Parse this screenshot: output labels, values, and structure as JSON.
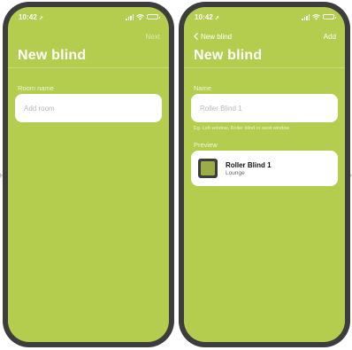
{
  "status_bar": {
    "time": "10:42",
    "location_glyph": "➚"
  },
  "screen1": {
    "nav_action": "Next",
    "title": "New blind",
    "field_label": "Room name",
    "field_placeholder": "Add room"
  },
  "screen2": {
    "back_label": "New blind",
    "nav_action": "Add",
    "title": "New blind",
    "field_label": "Name",
    "field_placeholder": "Roller Blind 1",
    "field_hint": "Eg. Left window, Roller blind or west window",
    "preview_label": "Preview",
    "preview_name": "Roller Blind 1",
    "preview_room": "Lounge"
  },
  "colors": {
    "background": "#b5cd4f",
    "frame": "#3d3d3d",
    "card": "#ffffff"
  },
  "icons": [
    "location-arrow-icon",
    "signal-icon",
    "wifi-icon",
    "battery-icon",
    "chevron-left-icon",
    "blind-icon"
  ]
}
